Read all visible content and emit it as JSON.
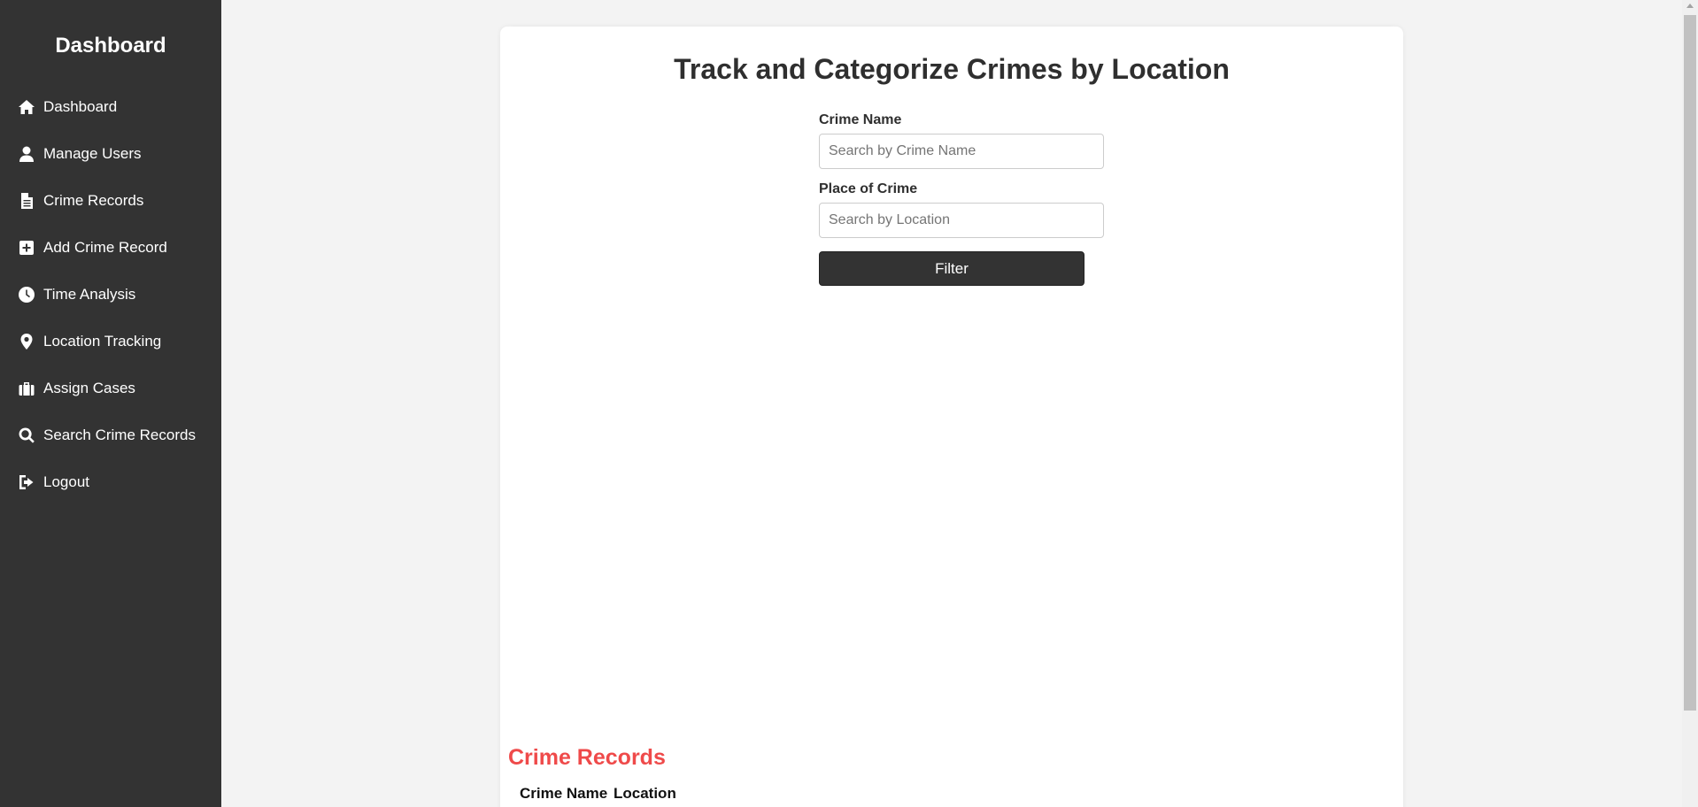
{
  "sidebar": {
    "title": "Dashboard",
    "items": [
      {
        "label": "Dashboard",
        "icon": "home-icon"
      },
      {
        "label": "Manage Users",
        "icon": "user-icon"
      },
      {
        "label": "Crime Records",
        "icon": "document-icon"
      },
      {
        "label": "Add Crime Record",
        "icon": "plus-square-icon"
      },
      {
        "label": "Time Analysis",
        "icon": "clock-icon"
      },
      {
        "label": "Location Tracking",
        "icon": "map-pin-icon"
      },
      {
        "label": "Assign Cases",
        "icon": "briefcase-icon"
      },
      {
        "label": "Search Crime Records",
        "icon": "search-icon"
      },
      {
        "label": "Logout",
        "icon": "logout-icon"
      }
    ]
  },
  "main": {
    "title": "Track and Categorize Crimes by Location",
    "crime_name": {
      "label": "Crime Name",
      "placeholder": "Search by Crime Name",
      "value": ""
    },
    "place": {
      "label": "Place of Crime",
      "placeholder": "Search by Location",
      "value": ""
    },
    "filter_label": "Filter",
    "records_title": "Crime Records",
    "table_headers": [
      "Crime Name",
      "Location"
    ]
  },
  "colors": {
    "sidebar_bg": "#333333",
    "accent_red": "#ef4a4a",
    "button_bg": "#333333",
    "page_bg": "#f3f3f3"
  }
}
